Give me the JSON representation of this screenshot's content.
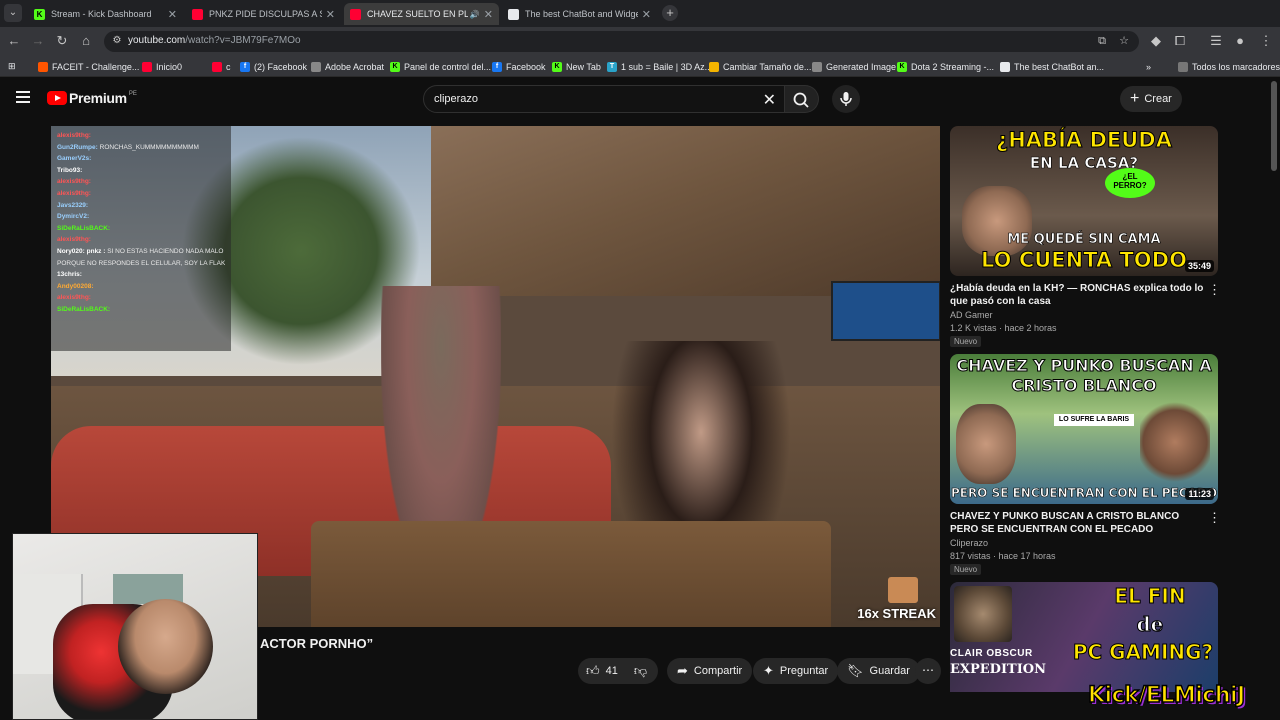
{
  "browser": {
    "tabs": [
      {
        "title": "Stream - Kick Dashboard",
        "favicon_color": "#53fc18",
        "favicon_glyph": "K",
        "active": false
      },
      {
        "title": "PNKZ PIDE DISCULPAS A SU FA",
        "favicon_color": "#ff0033",
        "favicon_glyph": "",
        "active": false
      },
      {
        "title": "CHAVEZ SUELTO EN PLAZA",
        "favicon_color": "#ff0033",
        "favicon_glyph": "",
        "active": true,
        "audio": true
      },
      {
        "title": "The best ChatBot and Widgets",
        "favicon_color": "#e8eaed",
        "favicon_glyph": "",
        "active": false
      }
    ],
    "url_host": "youtube.com",
    "url_rest": "/watch?v=JBM79Fe7MOo",
    "bookmarks": [
      {
        "label": "FACEIT - Challenge...",
        "color": "#ff5500"
      },
      {
        "label": "Inicio0",
        "color": "#ff0033"
      },
      {
        "label": "c",
        "color": "#ff0033"
      },
      {
        "label": "(2) Facebook",
        "color": "#1877f2"
      },
      {
        "label": "Adobe Acrobat",
        "color": "#888888"
      },
      {
        "label": "Panel de control del...",
        "color": "#53fc18"
      },
      {
        "label": "Facebook",
        "color": "#1877f2"
      },
      {
        "label": "New Tab",
        "color": "#53fc18"
      },
      {
        "label": "1 sub = Baile | 3D Az...",
        "color": "#2aa3c9"
      },
      {
        "label": "Cambiar Tamaño de...",
        "color": "#f4b400"
      },
      {
        "label": "Generated Image",
        "color": "#888888"
      },
      {
        "label": "Dota 2 Streaming -...",
        "color": "#53fc18"
      },
      {
        "label": "The best ChatBot an...",
        "color": "#e8eaed"
      }
    ],
    "bookmarks_overflow": "»",
    "all_bookmarks": "Todos los marcadores"
  },
  "youtube": {
    "logo_text": "Premium",
    "logo_region": "PE",
    "search_query": "cliperazo",
    "create_label": "Crear",
    "video": {
      "title_visible": "ACTOR PORNHO”",
      "likes": "41",
      "share_label": "Compartir",
      "ask_label": "Preguntar",
      "save_label": "Guardar",
      "streak": "16x STREAK"
    },
    "chat": [
      {
        "user": "alexis9thg:",
        "msg": "",
        "color": "#ff5555"
      },
      {
        "user": "Gun2Rumpe:",
        "msg": "RONCHAS_KUMMMMMMMMMM",
        "color": "#9ad0ff"
      },
      {
        "user": "GamerV2s:",
        "msg": "",
        "color": "#9ad0ff"
      },
      {
        "user": "Tribo93:",
        "msg": "",
        "color": "#ffffff"
      },
      {
        "user": "alexis9thg:",
        "msg": "",
        "color": "#ff5555"
      },
      {
        "user": "alexis9thg:",
        "msg": "",
        "color": "#ff5555"
      },
      {
        "user": "Javs2329:",
        "msg": "",
        "color": "#9ad0ff"
      },
      {
        "user": "DymircV2:",
        "msg": "",
        "color": "#9ad0ff"
      },
      {
        "user": "SiDeRaLisBACK:",
        "msg": "",
        "color": "#53fc18"
      },
      {
        "user": "alexis9thg:",
        "msg": "",
        "color": "#ff5555"
      },
      {
        "user": "Nory020: pnkz :",
        "msg": "SI NO ESTAS HACIENDO NADA MALO",
        "color": "#ffffff"
      },
      {
        "user": "",
        "msg": "PORQUE NO RESPONDES EL CELULAR, SOY LA FLAKY",
        "color": "#ffffff"
      },
      {
        "user": "13chris:",
        "msg": "",
        "color": "#ffffff"
      },
      {
        "user": "Andy00208:",
        "msg": "",
        "color": "#ffaa33"
      },
      {
        "user": "alexis9thg:",
        "msg": "",
        "color": "#ff5555"
      },
      {
        "user": "SiDeRaLisBACK:",
        "msg": "",
        "color": "#53fc18"
      }
    ],
    "recommendations": [
      {
        "thumb_line1": "¿HABÍA DEUDA",
        "thumb_line2": "EN LA CASA?",
        "thumb_line3": "ME QUEDÉ SIN CAMA",
        "thumb_line4": "LO CUENTA TODO",
        "thumb_tag": "¿EL PERRO?",
        "duration": "35:49",
        "title": "¿Había deuda en la KH? — RONCHAS explica todo lo que pasó con la casa",
        "channel": "AD Gamer",
        "meta": "1.2 K vistas · hace 2 horas",
        "badge": "Nuevo"
      },
      {
        "thumb_line1": "CHAVEZ Y PUNKO BUSCAN A",
        "thumb_line2": "CRISTO BLANCO",
        "thumb_line3": "PERO SE ENCUENTRAN CON EL PECADO",
        "thumb_tag": "LO SUFRE LA BARIS",
        "duration": "11:23",
        "title": "CHAVEZ Y PUNKO BUSCAN A CRISTO BLANCO PERO SE ENCUENTRAN CON EL PECADO",
        "channel": "Cliperazo",
        "meta": "817 vistas · hace 17 horas",
        "badge": "Nuevo"
      },
      {
        "thumb_line1": "EL FIN",
        "thumb_line2": "de",
        "thumb_line3": "PC GAMING?",
        "thumb_side1": "CLAIR OBSCUR",
        "thumb_side2": "EXPEDITION"
      }
    ],
    "watermark": "Kick/ELMichiJ"
  }
}
